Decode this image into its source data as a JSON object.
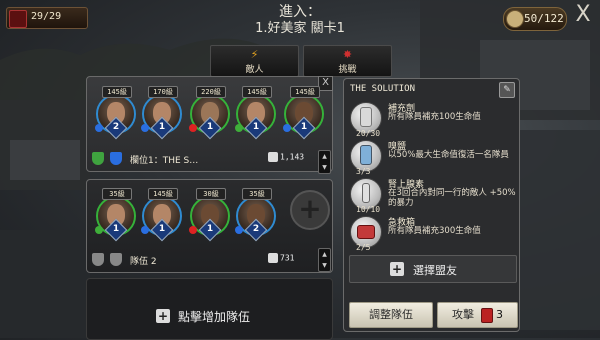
{
  "top_bar": {
    "ticket_count": "29/29",
    "energy": "50/122",
    "close": "X"
  },
  "header": {
    "title_line1": "進入：",
    "title_line2": "1.好美家 關卡1"
  },
  "tabs": [
    {
      "label": "敵人",
      "icon": "lightning-icon"
    },
    {
      "label": "挑戰",
      "icon": "star-icon"
    }
  ],
  "team1": {
    "heroes": [
      {
        "level": "145級",
        "rank": "2",
        "border": "#2f8bd1"
      },
      {
        "level": "170級",
        "rank": "1",
        "border": "#2f8bd1"
      },
      {
        "level": "220級",
        "rank": "1",
        "border": "#35b23a"
      },
      {
        "level": "145級",
        "rank": "1",
        "border": "#35b23a"
      },
      {
        "level": "145級",
        "rank": "1",
        "border": "#35b23a"
      }
    ],
    "name": "欄位1：THE S…",
    "power": "1,143",
    "close": "X"
  },
  "team2": {
    "heroes": [
      {
        "level": "35級",
        "rank": "1",
        "border": "#35b23a"
      },
      {
        "level": "145級",
        "rank": "1",
        "border": "#2f8bd1"
      },
      {
        "level": "30級",
        "rank": "1",
        "border": "#35b23a"
      },
      {
        "level": "35級",
        "rank": "2",
        "border": "#2f8bd1"
      }
    ],
    "name": "隊伍 2",
    "power": "731"
  },
  "add_team_label": "點擊增加隊伍",
  "solution_panel": {
    "title": "THE SOLUTION",
    "items": [
      {
        "name": "補充劑",
        "desc": "所有隊員補充100生命值",
        "count": "20/30",
        "color": "#d9d9d9"
      },
      {
        "name": "嗅鹽",
        "desc": "以50%最大生命值復活一名隊員",
        "count": "3/3",
        "color": "#7fb0d8"
      },
      {
        "name": "腎上腺素",
        "desc": "在3回合內對同一行的敵人 +50%的暴力",
        "count": "10/10",
        "color": "#e0e0e0"
      },
      {
        "name": "急救箱",
        "desc": "所有隊員補充300生命值",
        "count": "2/5",
        "color": "#c33a3a"
      }
    ],
    "select_friend": "選擇盟友",
    "adjust_team": "調整隊伍",
    "attack": "攻擊",
    "attack_cost": "3"
  }
}
